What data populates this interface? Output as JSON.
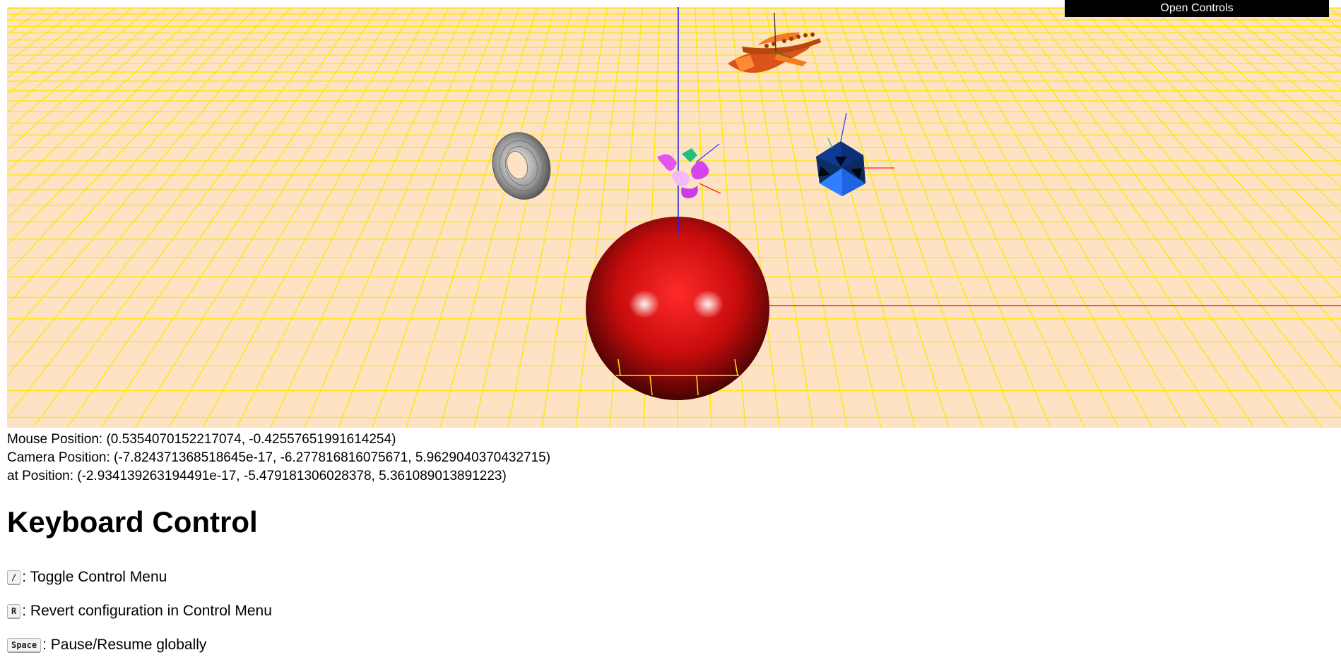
{
  "controls_toggle": {
    "label": "Open Controls"
  },
  "scene": {
    "floor_color": "#fde3c4",
    "grid_color": "#ffe600",
    "sphere_color": "#e21010",
    "x_axis_color": "#ff2020",
    "y_axis_color": "#0000ff",
    "objects": [
      "red-sphere",
      "torus",
      "icosahedron",
      "flower-cluster",
      "orange-creature"
    ]
  },
  "readouts": {
    "mouse": "Mouse Position: (0.5354070152217074, -0.42557651991614254)",
    "camera": "Camera Position: (-7.824371368518645e-17, -6.277816816075671, 5.9629040370432715)",
    "at": "at Position: (-2.934139263194491e-17, -5.479181306028378, 5.361089013891223)"
  },
  "keyboard": {
    "title": "Keyboard Control",
    "items": [
      {
        "key": "/",
        "description": ": Toggle Control Menu"
      },
      {
        "key": "R",
        "description": ": Revert configuration in Control Menu"
      },
      {
        "key": "Space",
        "description": ": Pause/Resume globally"
      }
    ]
  }
}
